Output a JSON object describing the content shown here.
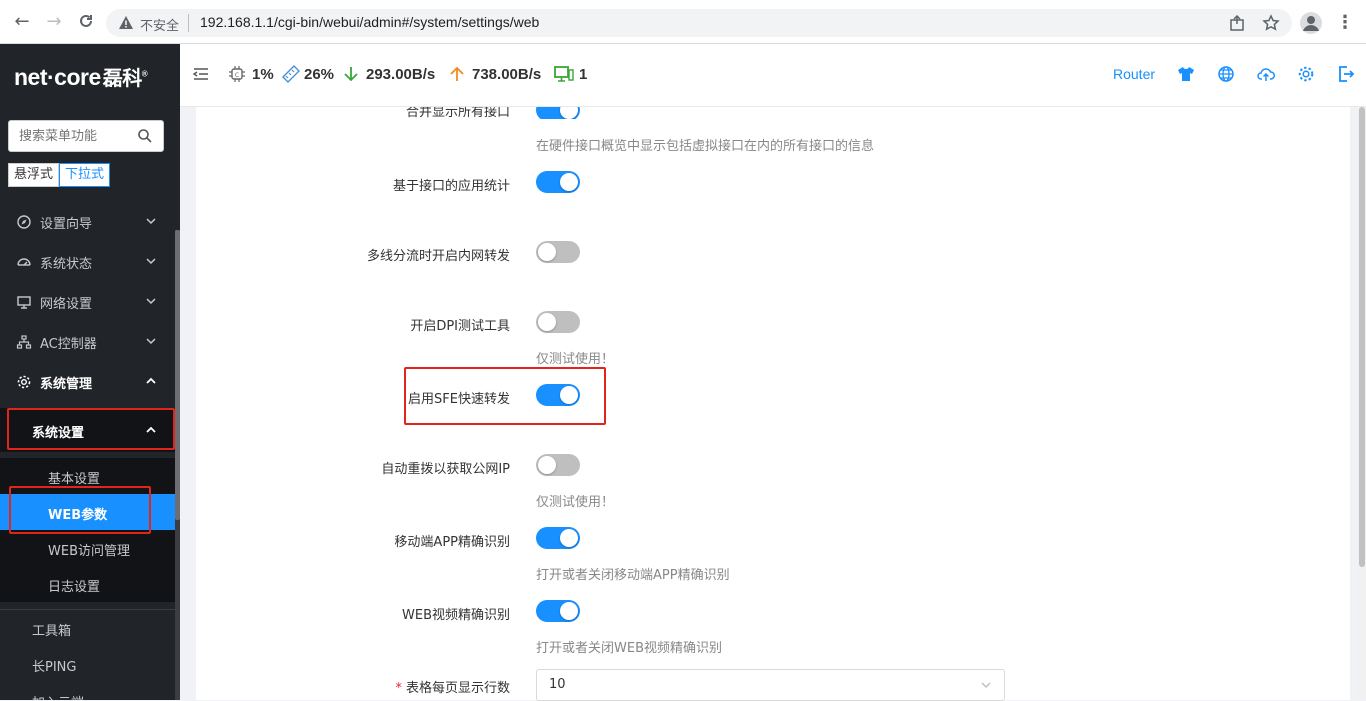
{
  "browser": {
    "insecure_label": "不安全",
    "url": "192.168.1.1/cgi-bin/webui/admin#/system/settings/web"
  },
  "sidebar": {
    "brand": "net·core",
    "brand_cn": "磊科",
    "search_placeholder": "搜索菜单功能",
    "mode_float": "悬浮式",
    "mode_dropdown": "下拉式",
    "menu": [
      {
        "label": "设置向导",
        "icon": "compass-icon"
      },
      {
        "label": "系统状态",
        "icon": "dashboard-icon"
      },
      {
        "label": "网络设置",
        "icon": "monitor-icon"
      },
      {
        "label": "AC控制器",
        "icon": "sitemap-icon"
      },
      {
        "label": "系统管理",
        "icon": "gear-icon"
      }
    ],
    "submenu_open": "系统设置",
    "subitems": [
      "基本设置",
      "WEB参数",
      "WEB访问管理",
      "日志设置"
    ],
    "tools": [
      "工具箱",
      "长PING",
      "加入云端"
    ]
  },
  "header": {
    "cpu": "1%",
    "mem": "26%",
    "down": "293.00B/s",
    "up": "738.00B/s",
    "clients": "1",
    "router": "Router"
  },
  "settings": {
    "row0_label": "合并显示所有接口",
    "row0_hint": "在硬件接口概览中显示包括虚拟接口在内的所有接口的信息",
    "row1_label": "基于接口的应用统计",
    "row2_label": "多线分流时开启内网转发",
    "row3_label": "开启DPI测试工具",
    "row3_hint": "仅测试使用！",
    "row4_label": "启用SFE快速转发",
    "row5_label": "自动重拨以获取公网IP",
    "row5_hint": "仅测试使用！",
    "row6_label": "移动端APP精确识别",
    "row6_hint": "打开或者关闭移动端APP精确识别",
    "row7_label": "WEB视频精确识别",
    "row7_hint": "打开或者关闭WEB视频精确识别",
    "row8_req": "*",
    "row8_label": "表格每页显示行数",
    "row8_value": "10"
  },
  "colors": {
    "accent": "#1890ff",
    "sidebar": "#212429",
    "highlight": "#e1251b"
  }
}
